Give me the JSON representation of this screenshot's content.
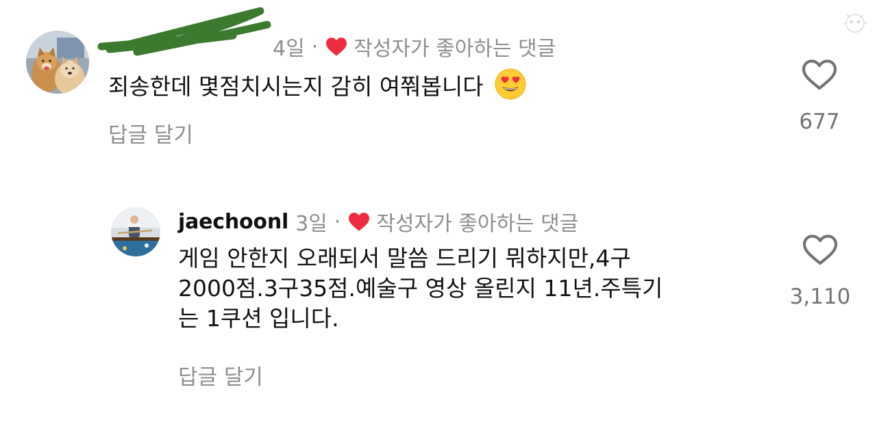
{
  "comments": [
    {
      "username": "",
      "time": "4일",
      "separator": "·",
      "liked_label": "작성자가 좋아하는 댓글",
      "text": "죄송한데 몇점치시는지 감히 여쭤봅니다",
      "reply_label": "답글 달기",
      "like_count": "677",
      "avatar_icon": "dogs-photo-avatar",
      "emoji": "heart-eyes-emoji"
    },
    {
      "username": "jaechoonl",
      "time": "3일",
      "separator": "·",
      "liked_label": "작성자가 좋아하는 댓글",
      "text_lines": [
        "게임 안한지 오래되서 말씀 드리기 뭐하지만,4구",
        "2000점.3구35점.예술구 영상 올린지 11년.주특기",
        "는 1쿠션 입니다."
      ],
      "reply_label": "답글 달기",
      "like_count": "3,110",
      "avatar_icon": "billiards-player-avatar"
    }
  ],
  "colors": {
    "liked_heart": "#ed2d3f",
    "secondary_text": "#8e8e8e",
    "primary_text": "#111111",
    "redaction_scribble": "#3b7a2f"
  },
  "icons": {
    "like": "heart-outline-icon",
    "author_liked": "filled-heart-icon"
  }
}
